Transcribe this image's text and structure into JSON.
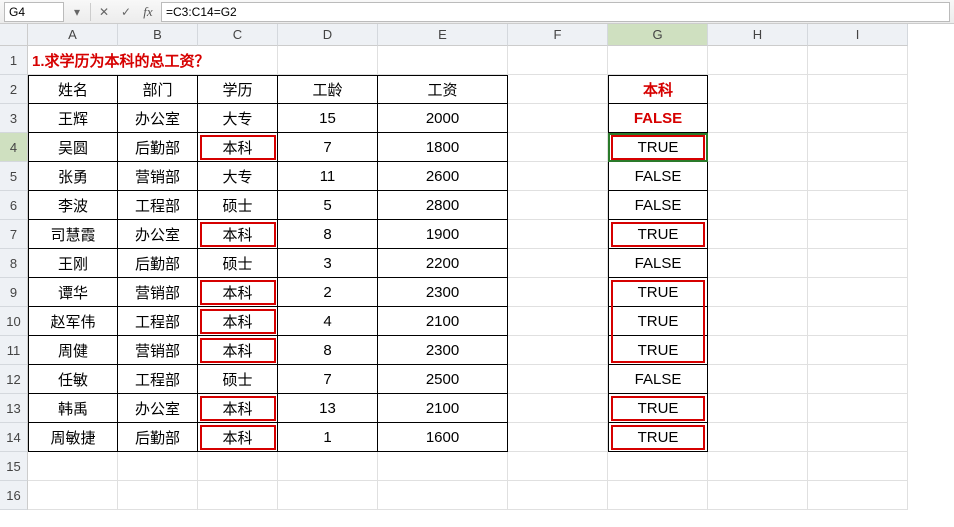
{
  "toolbar": {
    "namebox": "G4",
    "formula": "=C3:C14=G2"
  },
  "columns": [
    "A",
    "B",
    "C",
    "D",
    "E",
    "F",
    "G",
    "H",
    "I"
  ],
  "active_col": "G",
  "active_row": 4,
  "title": "1.求学历为本科的总工资？",
  "headers": {
    "A": "姓名",
    "B": "部门",
    "C": "学历",
    "D": "工龄",
    "E": "工资"
  },
  "g_header": "本科",
  "rows": [
    {
      "A": "王辉",
      "B": "办公室",
      "C": "大专",
      "D": "15",
      "E": "2000",
      "G": "FALSE"
    },
    {
      "A": "吴圆",
      "B": "后勤部",
      "C": "本科",
      "D": "7",
      "E": "1800",
      "G": "TRUE"
    },
    {
      "A": "张勇",
      "B": "营销部",
      "C": "大专",
      "D": "11",
      "E": "2600",
      "G": "FALSE"
    },
    {
      "A": "李波",
      "B": "工程部",
      "C": "硕士",
      "D": "5",
      "E": "2800",
      "G": "FALSE"
    },
    {
      "A": "司慧霞",
      "B": "办公室",
      "C": "本科",
      "D": "8",
      "E": "1900",
      "G": "TRUE"
    },
    {
      "A": "王刚",
      "B": "后勤部",
      "C": "硕士",
      "D": "3",
      "E": "2200",
      "G": "FALSE"
    },
    {
      "A": "谭华",
      "B": "营销部",
      "C": "本科",
      "D": "2",
      "E": "2300",
      "G": "TRUE"
    },
    {
      "A": "赵军伟",
      "B": "工程部",
      "C": "本科",
      "D": "4",
      "E": "2100",
      "G": "TRUE"
    },
    {
      "A": "周健",
      "B": "营销部",
      "C": "本科",
      "D": "8",
      "E": "2300",
      "G": "TRUE"
    },
    {
      "A": "任敏",
      "B": "工程部",
      "C": "硕士",
      "D": "7",
      "E": "2500",
      "G": "FALSE"
    },
    {
      "A": "韩禹",
      "B": "办公室",
      "C": "本科",
      "D": "13",
      "E": "2100",
      "G": "TRUE"
    },
    {
      "A": "周敏捷",
      "B": "后勤部",
      "C": "本科",
      "D": "1",
      "E": "1600",
      "G": "TRUE"
    }
  ],
  "highlight_c_rows": [
    4,
    7,
    9,
    10,
    11,
    13,
    14
  ],
  "highlight_g_single_rows": [
    4,
    7,
    13,
    14
  ],
  "highlight_g_block": {
    "start": 9,
    "end": 11
  }
}
